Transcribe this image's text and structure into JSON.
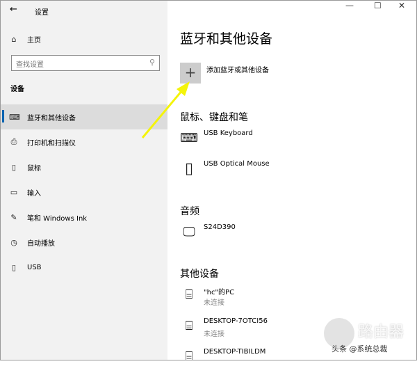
{
  "window": {
    "title": "设置",
    "back": "←",
    "minimize": "—",
    "maximize": "☐",
    "close": "✕"
  },
  "sidebar": {
    "home": "主页",
    "search_placeholder": "查找设置",
    "section": "设备",
    "items": [
      {
        "label": "蓝牙和其他设备",
        "icon": "⌨"
      },
      {
        "label": "打印机和扫描仪",
        "icon": "⎙"
      },
      {
        "label": "鼠标",
        "icon": "⌂"
      },
      {
        "label": "输入",
        "icon": "▭"
      },
      {
        "label": "笔和 Windows Ink",
        "icon": "✎"
      },
      {
        "label": "自动播放",
        "icon": "◷"
      },
      {
        "label": "USB",
        "icon": "▯"
      }
    ]
  },
  "main": {
    "title": "蓝牙和其他设备",
    "add_label": "添加蓝牙或其他设备",
    "sections": [
      {
        "heading": "鼠标、键盘和笔",
        "devices": [
          {
            "name": "USB Keyboard",
            "status": ""
          },
          {
            "name": "USB Optical Mouse",
            "status": ""
          }
        ]
      },
      {
        "heading": "音频",
        "devices": [
          {
            "name": "S24D390",
            "status": ""
          }
        ]
      },
      {
        "heading": "其他设备",
        "devices": [
          {
            "name": "\"hc\"的PC",
            "status": "未连接"
          },
          {
            "name": "DESKTOP-7OTCI56",
            "status": "未连接"
          },
          {
            "name": "DESKTOP-TIBILDM",
            "status": ""
          }
        ]
      }
    ]
  },
  "watermark": {
    "brand": "路由器",
    "credit": "头条 @系统总裁"
  },
  "colors": {
    "accent": "#0063b1",
    "arrow": "#f4f40a"
  }
}
